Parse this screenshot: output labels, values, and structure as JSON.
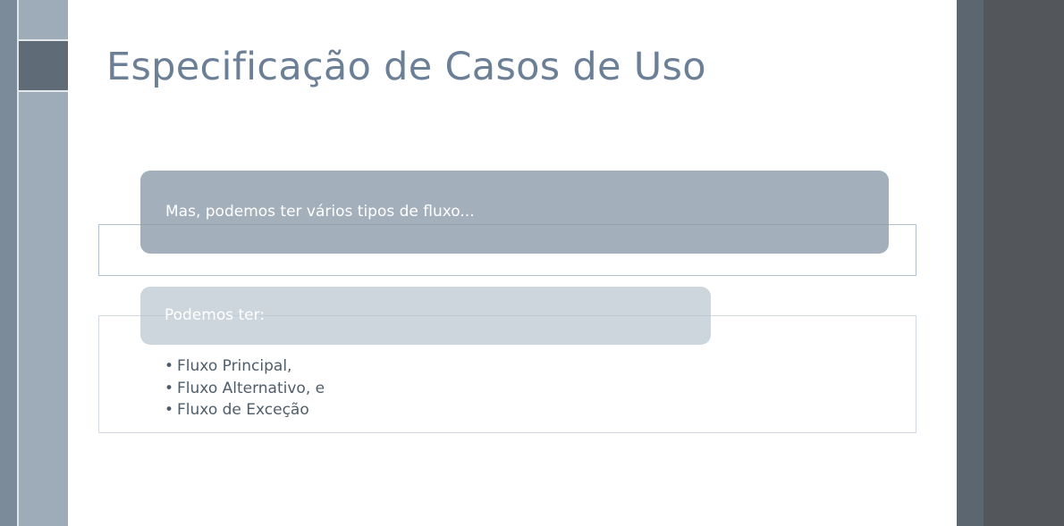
{
  "slide": {
    "title": "Especificação de Casos de Uso",
    "callout_primary": "Mas, podemos ter vários tipos de fluxo...",
    "callout_secondary": "Podemos ter:",
    "bullet_glyph": "•",
    "bullets": [
      "Fluxo Principal,",
      "Fluxo Alternativo, e",
      "Fluxo de Exceção"
    ]
  },
  "colors": {
    "title": "#6b8096",
    "callout_primary_bg": "#8c9baa",
    "callout_secondary_bg": "#b9c4cf",
    "bullet_text": "#4f5d6b",
    "app_background": "#53575b"
  }
}
